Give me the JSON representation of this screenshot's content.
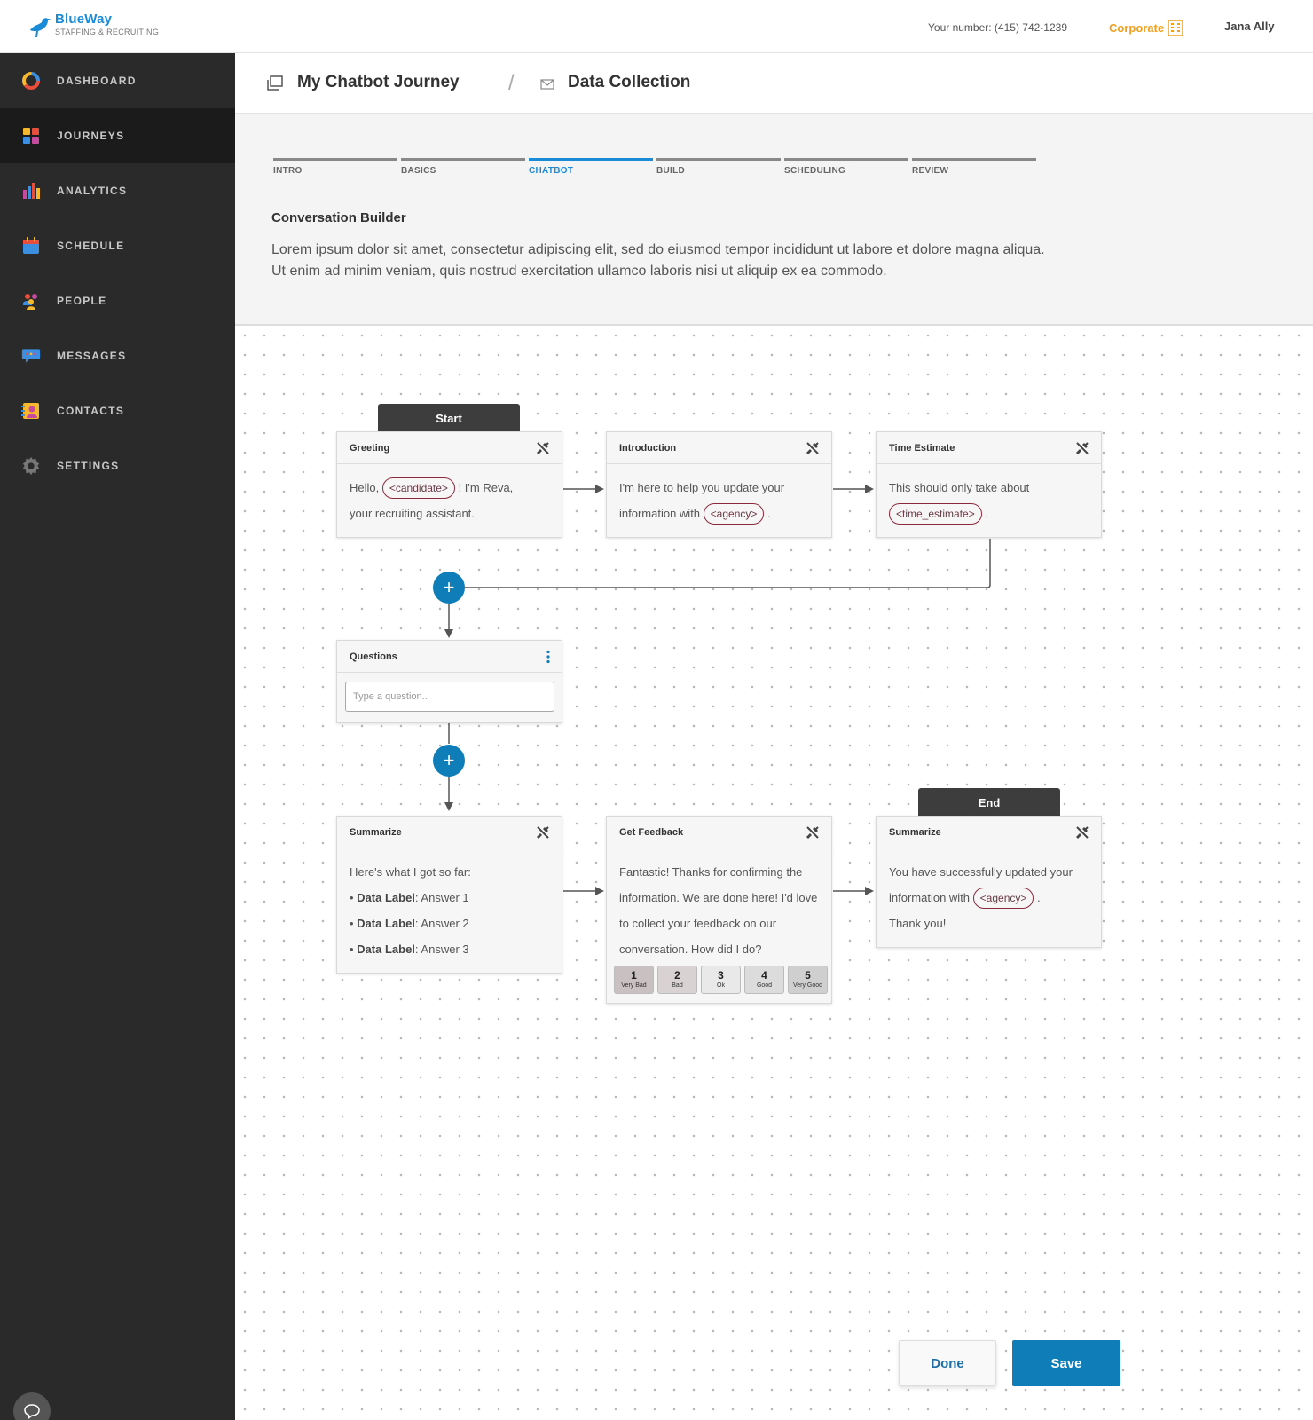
{
  "header": {
    "brand": "BlueWay",
    "tagline": "STAFFING & RECRUITING",
    "phone": "Your number: (415) 742-1239",
    "org": "Corporate",
    "user": "Jana Ally"
  },
  "sidebar": {
    "items": [
      {
        "label": "DASHBOARD",
        "icon": "donut-chart-icon"
      },
      {
        "label": "JOURNEYS",
        "icon": "grid-icon",
        "active": true
      },
      {
        "label": "ANALYTICS",
        "icon": "bar-chart-icon"
      },
      {
        "label": "SCHEDULE",
        "icon": "calendar-icon"
      },
      {
        "label": "PEOPLE",
        "icon": "people-icon"
      },
      {
        "label": "MESSAGES",
        "icon": "chat-icon"
      },
      {
        "label": "CONTACTS",
        "icon": "contact-card-icon"
      },
      {
        "label": "SETTINGS",
        "icon": "gear-icon"
      }
    ]
  },
  "breadcrumb": {
    "journey": "My Chatbot Journey",
    "separator": "/",
    "page": "Data Collection"
  },
  "steps": [
    "INTRO",
    "BASICS",
    "CHATBOT",
    "BUILD",
    "SCHEDULING",
    "REVIEW"
  ],
  "active_step": "CHATBOT",
  "builder": {
    "title": "Conversation Builder",
    "description": "Lorem ipsum dolor sit amet, consectetur adipiscing elit, sed do eiusmod tempor incididunt ut labore et dolore magna aliqua. Ut enim ad minim veniam, quis nostrud exercitation ullamco laboris nisi ut aliquip ex ea commodo."
  },
  "flow": {
    "start_label": "Start",
    "end_label": "End",
    "greeting": {
      "title": "Greeting",
      "text1": "Hello,",
      "var": "<candidate>",
      "text2": "! I'm Reva,",
      "text3": "your recruiting assistant."
    },
    "introduction": {
      "title": "Introduction",
      "text1": "I'm here to help you update your",
      "text2": "information with",
      "var": "<agency>",
      "text3": "."
    },
    "time_estimate": {
      "title": "Time Estimate",
      "text1": "This should only take about",
      "var": "<time_estimate>",
      "text2": "."
    },
    "questions": {
      "title": "Questions",
      "placeholder": "Type a question.."
    },
    "summarize": {
      "title": "Summarize",
      "intro": "Here's what I got so far:",
      "items": [
        {
          "label": "Data Label",
          "value": ": Answer 1"
        },
        {
          "label": "Data Label",
          "value": ": Answer 2"
        },
        {
          "label": "Data Label",
          "value": ": Answer 3"
        }
      ]
    },
    "feedback": {
      "title": "Get Feedback",
      "text": "Fantastic! Thanks for confirming the information. We are done here! I'd love to collect your feedback on our conversation. How did I do?",
      "ratings": [
        {
          "n": "1",
          "label": "Very Bad"
        },
        {
          "n": "2",
          "label": "Bad"
        },
        {
          "n": "3",
          "label": "Ok"
        },
        {
          "n": "4",
          "label": "Good"
        },
        {
          "n": "5",
          "label": "Very Good"
        }
      ]
    },
    "end_summary": {
      "title": "Summarize",
      "text1": "You have successfully updated your",
      "text2": "information with",
      "var": "<agency>",
      "text3": ".",
      "text4": "Thank you!"
    },
    "plus_symbol": "+"
  },
  "actions": {
    "done": "Done",
    "save": "Save"
  },
  "colors": {
    "accent": "#0f7db8",
    "brand": "#1a8bd6",
    "org": "#f0a020",
    "pill": "#8b2a3d"
  }
}
